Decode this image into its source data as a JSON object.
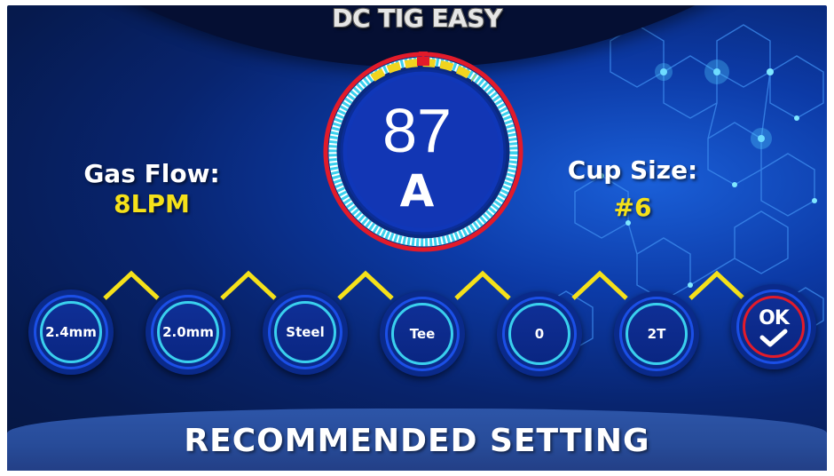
{
  "header": {
    "title": "DC TIG EASY"
  },
  "dial": {
    "value": "87",
    "unit": "A"
  },
  "gas_flow": {
    "label": "Gas Flow:",
    "value": "8LPM"
  },
  "cup_size": {
    "label": "Cup Size:",
    "value": "#6"
  },
  "options": [
    {
      "name": "electrode-size-option",
      "label": "2.4mm"
    },
    {
      "name": "filler-size-option",
      "label": "2.0mm"
    },
    {
      "name": "material-option",
      "label": "Steel"
    },
    {
      "name": "joint-type-option",
      "label": "Tee"
    },
    {
      "name": "position-option",
      "label": "0"
    },
    {
      "name": "trigger-mode-option",
      "label": "2T"
    }
  ],
  "ok_button": {
    "label": "OK",
    "icon": "checkmark-icon"
  },
  "footer": {
    "label": "RECOMMENDED SETTING"
  },
  "colors": {
    "accent_yellow": "#f5e11a",
    "ring_cyan": "#3ad0ee",
    "ok_red": "#e21b2a",
    "background_blue": "#0c3aa6"
  }
}
